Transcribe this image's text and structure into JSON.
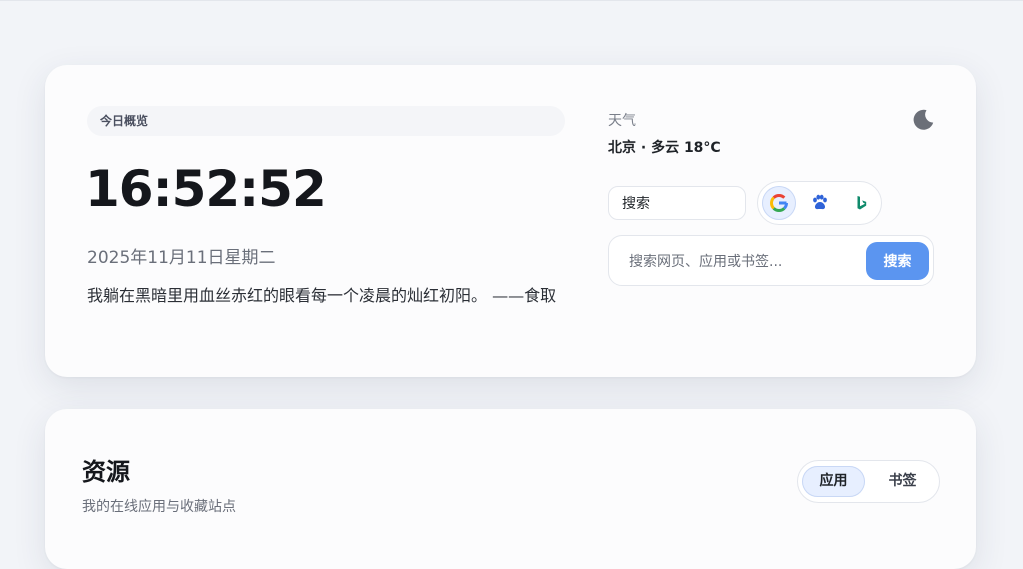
{
  "overview": {
    "label": "今日概览",
    "time": "16:52:52",
    "date": "2025年11月11日星期二",
    "quote": "我躺在黑暗里用血丝赤红的眼看每一个凌晨的灿红初阳。 ——食取"
  },
  "weather": {
    "label": "天气",
    "value": "北京 · 多云 18°C"
  },
  "search": {
    "engine_label": "搜索",
    "engines": [
      "google-icon",
      "baidu-icon",
      "bing-icon"
    ],
    "active_engine": "google-icon",
    "placeholder": "搜索网页、应用或书签...",
    "button_label": "搜索"
  },
  "theme_toggle": {
    "icon": "moon-icon"
  },
  "resources": {
    "title": "资源",
    "subtitle": "我的在线应用与收藏站点",
    "tabs": [
      "应用",
      "书签"
    ],
    "active_tab": "应用"
  },
  "colors": {
    "accent": "#5b95f0",
    "active_bg": "#e7efff"
  }
}
